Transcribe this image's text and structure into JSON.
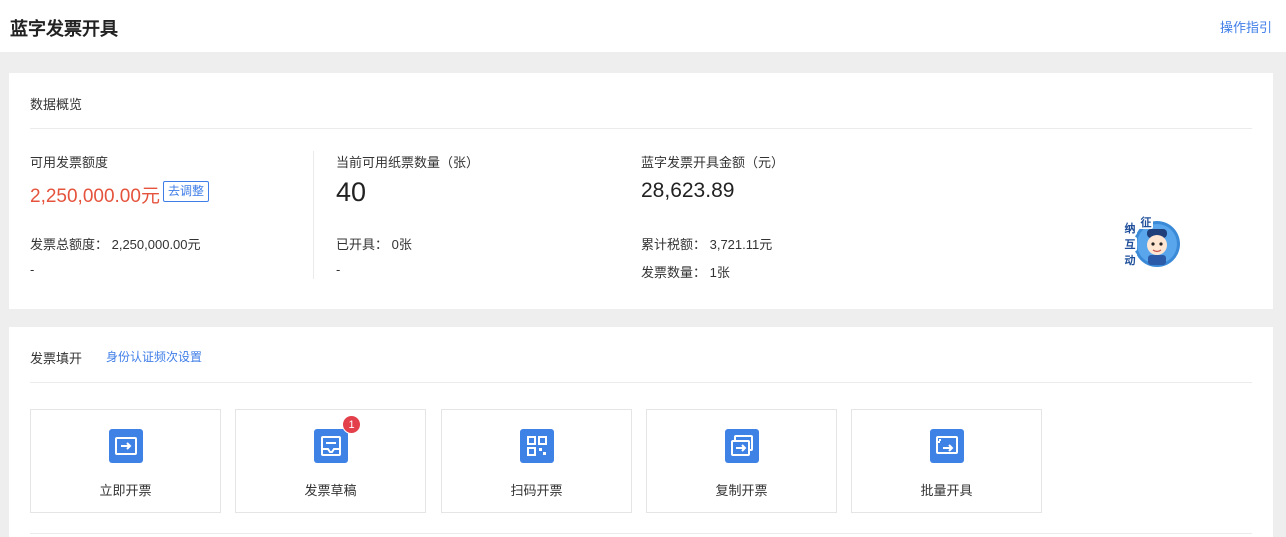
{
  "header": {
    "title": "蓝字发票开具",
    "guide_link": "操作指引"
  },
  "overview": {
    "title": "数据概览",
    "quota": {
      "label": "可用发票额度",
      "value": "2,250,000.00元",
      "adjust_button": "去调整",
      "total_line": "发票总额度： 2,250,000.00元",
      "extra": "-"
    },
    "paper": {
      "label": "当前可用纸票数量（张）",
      "value": "40",
      "issued_line": "已开具： 0张",
      "extra": "-"
    },
    "amount": {
      "label": "蓝字发票开具金额（元）",
      "value": "28,623.89",
      "tax_line": "累计税额： 3,721.11元",
      "count_line": "发票数量： 1张"
    },
    "mascot_text": [
      "征",
      "纳",
      "互",
      "动"
    ]
  },
  "filling": {
    "title": "发票填开",
    "identity_link": "身份认证频次设置",
    "tiles": [
      {
        "label": "立即开票",
        "icon": "ticket-arrow-icon"
      },
      {
        "label": "发票草稿",
        "icon": "draft-tray-icon",
        "badge": "1"
      },
      {
        "label": "扫码开票",
        "icon": "qr-code-icon"
      },
      {
        "label": "复制开票",
        "icon": "copy-ticket-icon"
      },
      {
        "label": "批量开具",
        "icon": "batch-ticket-icon"
      }
    ]
  },
  "colors": {
    "accent": "#3f7ee8",
    "icon_bg": "#3f82e6",
    "quota_red": "#e5533d",
    "badge_red": "#e4404b"
  }
}
